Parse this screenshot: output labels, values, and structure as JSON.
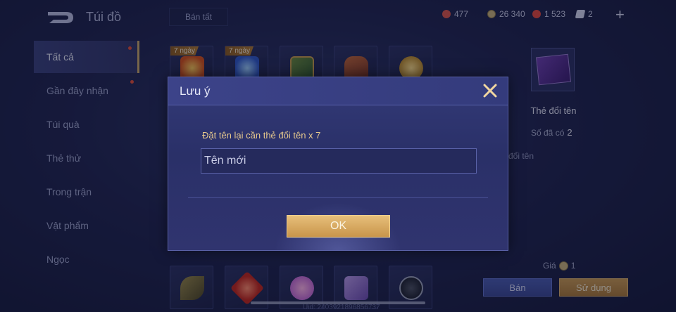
{
  "header": {
    "title": "Túi đồ",
    "sell_all_label": "Bán tất",
    "currencies": [
      {
        "icon": "red-gem-icon",
        "value": "477",
        "color": "#d9554a"
      },
      {
        "icon": "gold-coin-icon",
        "value": "26 340",
        "color": "#c8b27a"
      },
      {
        "icon": "ruby-icon",
        "value": "1 523",
        "color": "#e2473d"
      },
      {
        "icon": "voucher-icon",
        "value": "2",
        "color": "#d5d8f0"
      }
    ],
    "add_label": "+"
  },
  "sidebar": {
    "items": [
      {
        "label": "Tất cả",
        "active": true,
        "dot": true
      },
      {
        "label": "Gần đây nhận",
        "active": false,
        "dot": true
      },
      {
        "label": "Túi quà",
        "active": false,
        "dot": false
      },
      {
        "label": "Thẻ thử",
        "active": false,
        "dot": false
      },
      {
        "label": "Trong trận",
        "active": false,
        "dot": false
      },
      {
        "label": "Vật phẩm",
        "active": false,
        "dot": false
      },
      {
        "label": "Ngọc",
        "active": false,
        "dot": false
      }
    ]
  },
  "grid": {
    "top_row": [
      {
        "badge": "7 ngày",
        "icon": "fire-wing-icon"
      },
      {
        "badge": "7 ngày",
        "icon": "blue-potion-icon"
      },
      {
        "badge": "",
        "icon": "treasure-chest-icon"
      },
      {
        "badge": "",
        "icon": "armor-icon"
      },
      {
        "badge": "",
        "icon": "golden-horn-icon"
      }
    ],
    "bottom_row": [
      {
        "icon": "leaf-icon"
      },
      {
        "icon": "red-gem-item-icon"
      },
      {
        "icon": "hearts-icon"
      },
      {
        "icon": "puzzle-icon"
      },
      {
        "icon": "tap-gesture-icon"
      }
    ]
  },
  "detail": {
    "name": "Thẻ đổi tên",
    "owned_label": "Số đã có",
    "owned_value": "2",
    "description": "đổi tên",
    "price_label": "Giá",
    "price_value": "1",
    "sell_label": "Bán",
    "use_label": "Sử dụng"
  },
  "footer": {
    "uid": "Uid: 2403921896856737"
  },
  "dialog": {
    "title": "Lưu ý",
    "message": "Đặt tên lại cần thẻ đổi tên x 7",
    "input_placeholder": "Tên mới",
    "input_value": "",
    "ok_label": "OK"
  }
}
